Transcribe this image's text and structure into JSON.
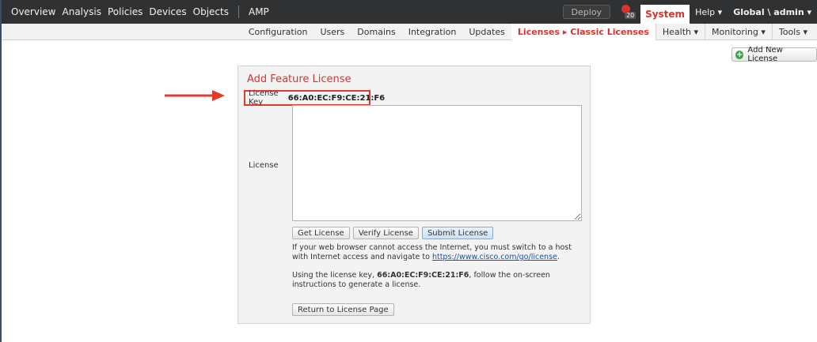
{
  "topnav": {
    "items": [
      "Overview",
      "Analysis",
      "Policies",
      "Devices",
      "Objects"
    ],
    "amp": "AMP",
    "deploy": "Deploy",
    "alert_count": "20",
    "system": "System",
    "help": "Help ▾",
    "domain_user": "Global \\ admin ▾"
  },
  "subnav": {
    "items": [
      "Configuration",
      "Users",
      "Domains",
      "Integration",
      "Updates"
    ],
    "active": "Licenses ▸ Classic Licenses",
    "right_items": [
      "Health ▾",
      "Monitoring ▾",
      "Tools ▾"
    ]
  },
  "toolbar": {
    "add_new_license": "Add New License"
  },
  "panel": {
    "title": "Add Feature License",
    "license_key_label": "License Key",
    "license_key_value": "66:A0:EC:F9:CE:21:F6",
    "license_label": "License",
    "license_value": "",
    "buttons": {
      "get_license": "Get License",
      "verify_license": "Verify License",
      "submit_license": "Submit License"
    },
    "info1_text": "If your web browser cannot access the Internet, you must switch to a host with Internet access and navigate to ",
    "info1_link": "https://www.cisco.com/go/license",
    "info1_end": ".",
    "info2_pre": "Using the license key, ",
    "info2_key": "66:A0:EC:F9:CE:21:F6",
    "info2_post": ", follow the on-screen instructions to generate a license.",
    "return_button": "Return to License Page"
  },
  "colors": {
    "topbar_bg": "#2f3133",
    "accent_red": "#d9342b",
    "arrow": "#e23b2e",
    "panel_bg": "#f3f3f3"
  }
}
